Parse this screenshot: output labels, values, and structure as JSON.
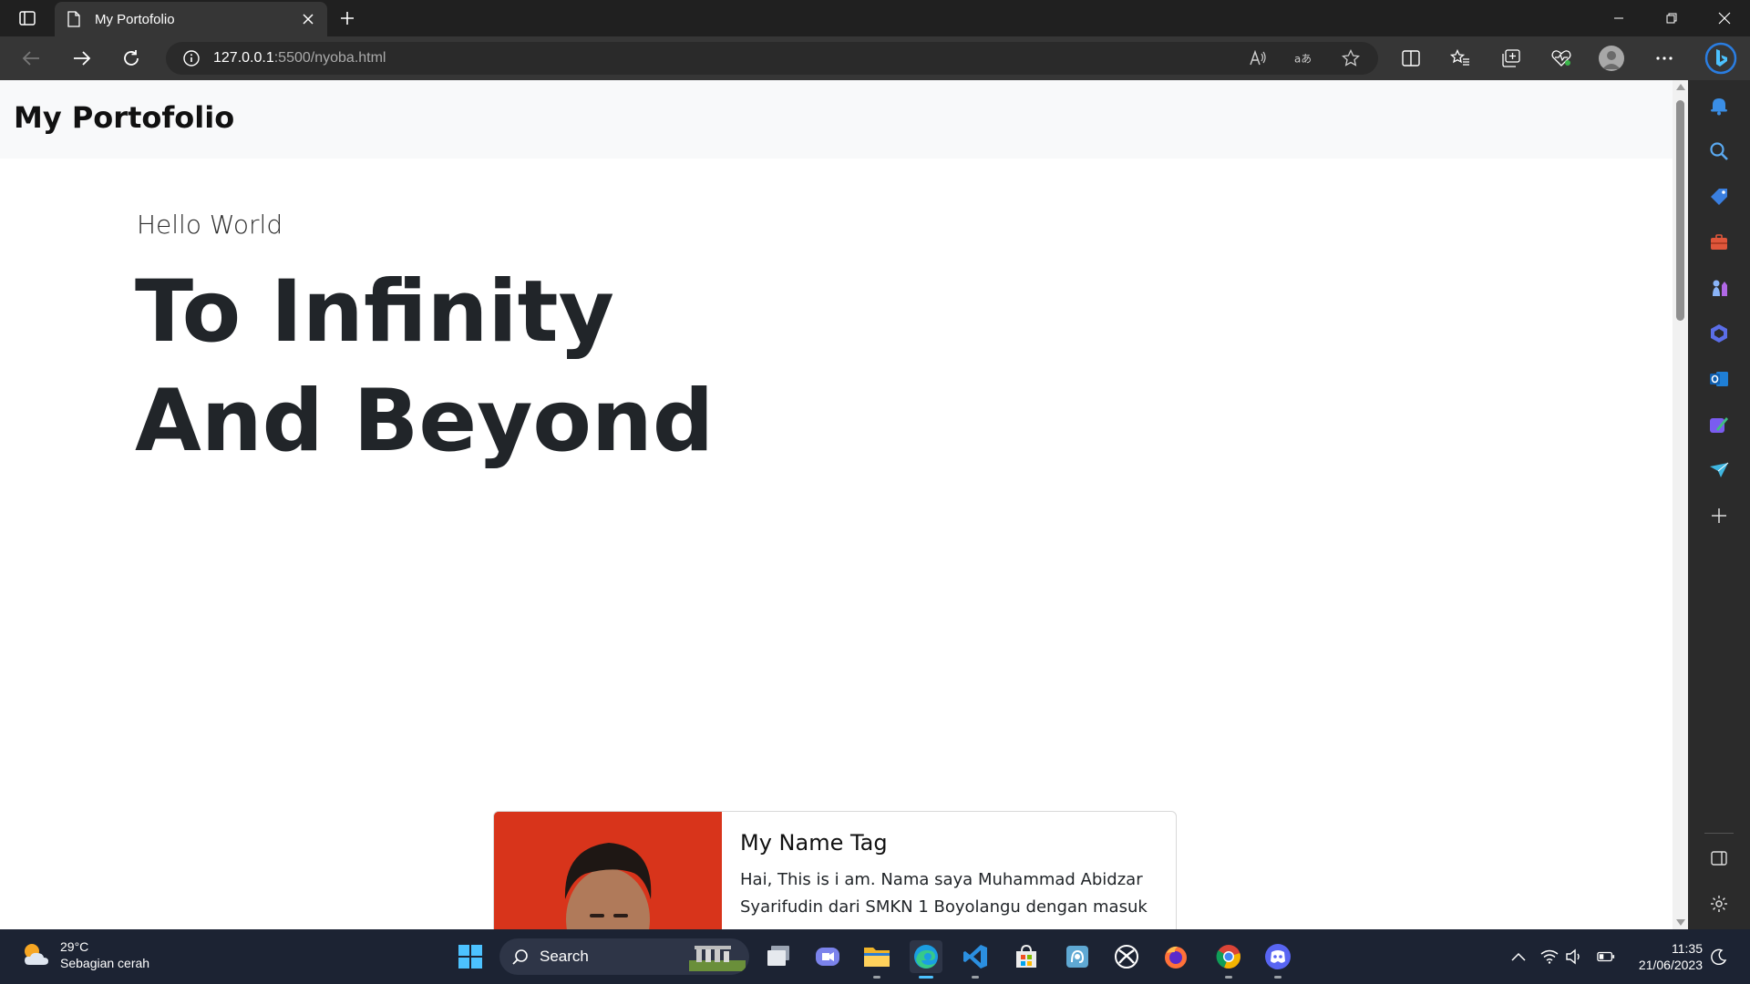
{
  "browser": {
    "tab": {
      "title": "My Portofolio"
    },
    "address": {
      "host": "127.0.0.1",
      "path": ":5500/nyoba.html"
    }
  },
  "page": {
    "brand": "My Portofolio",
    "hero": {
      "subtitle": "Hello World",
      "title_line1": "To Infinity",
      "title_line2": "And Beyond"
    },
    "card": {
      "title": "My Name Tag",
      "text": "Hai, This is i am. Nama saya Muhammad Abidzar Syarifudin dari SMKN 1 Boyolangu dengan masuk"
    }
  },
  "taskbar": {
    "weather": {
      "temp": "29°C",
      "desc": "Sebagian cerah"
    },
    "search_label": "Search",
    "clock": {
      "time": "11:35",
      "date": "21/06/2023"
    }
  },
  "colors": {
    "accent": "#4cc2ff",
    "card_photo_bg": "#d8341b",
    "navbar_bg": "#f8f9fa",
    "hero_text": "#212529"
  }
}
